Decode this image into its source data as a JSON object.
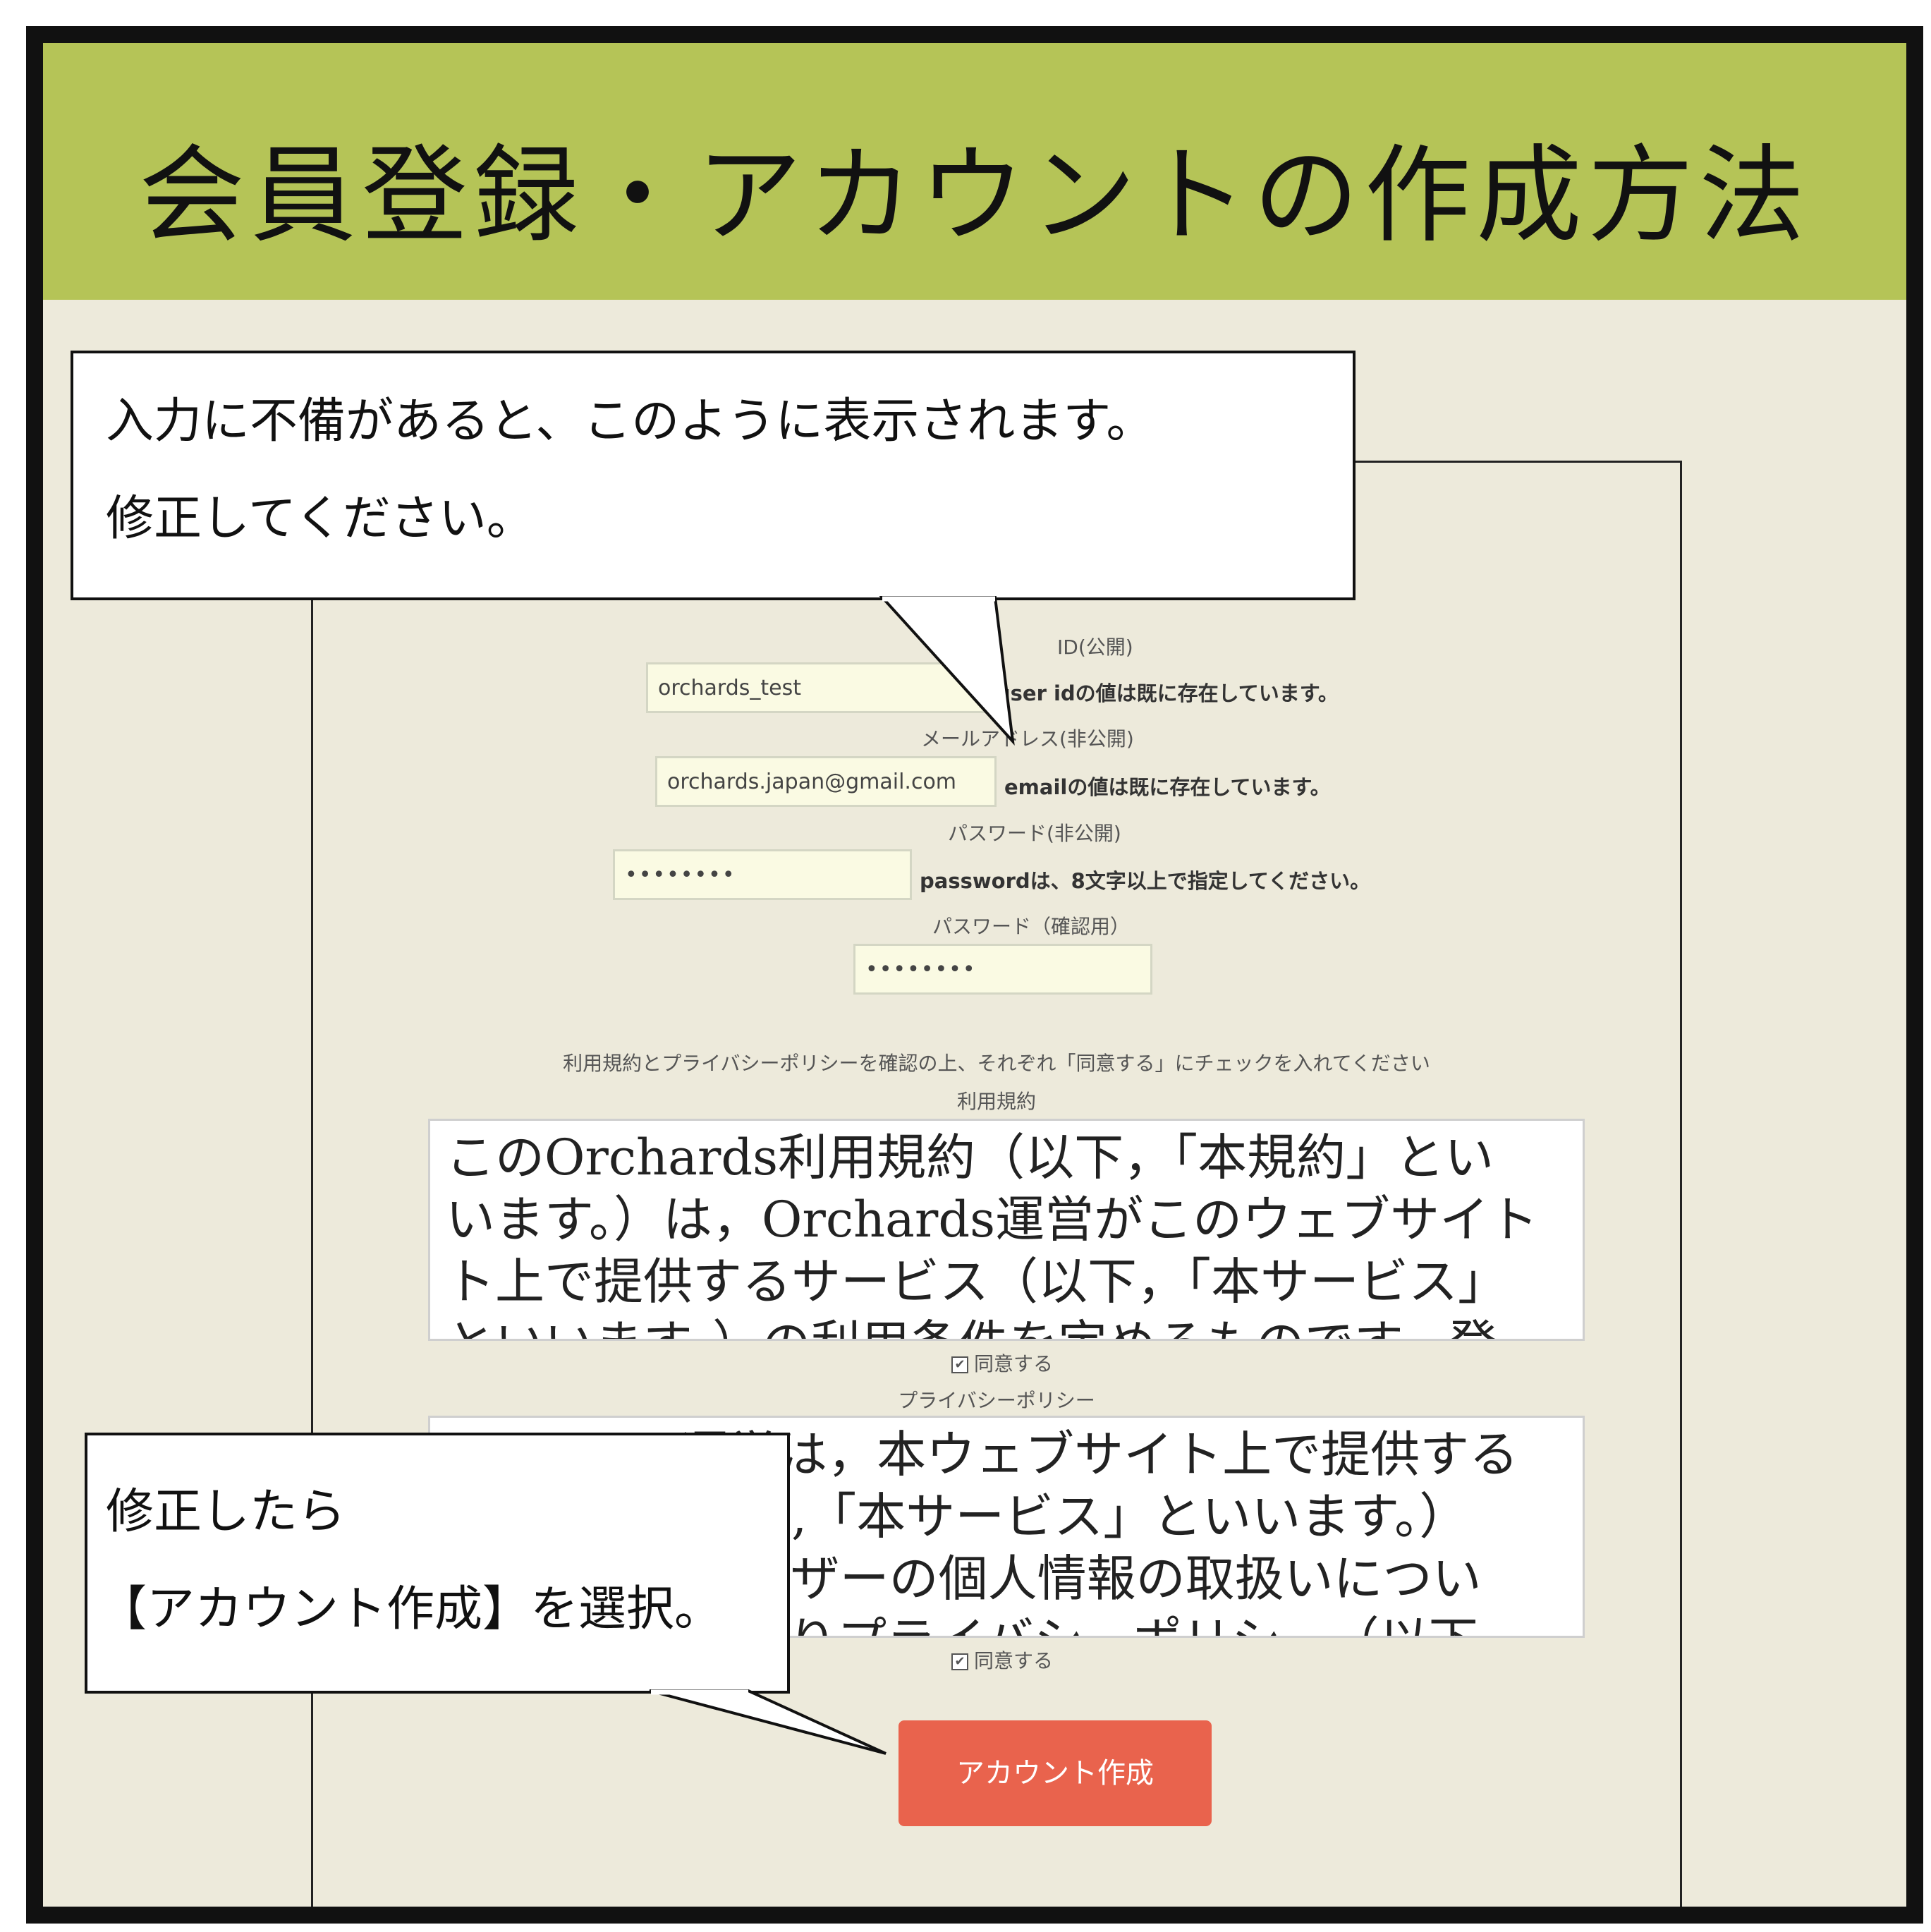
{
  "header": {
    "title": "会員登録・アカウントの作成方法"
  },
  "form": {
    "user_id_label": "ID(公開)",
    "user_id_value": "orchards_test",
    "user_id_error": "user idの値は既に存在しています。",
    "email_label": "メールアドレス(非公開)",
    "email_value": "orchards.japan@gmail.com",
    "email_error": "emailの値は既に存在しています。",
    "password_label": "パスワード(非公開)",
    "password_value": "••••••••",
    "password_error": "passwordは、8文字以上で指定してください。",
    "password_confirm_label": "パスワード（確認用）",
    "password_confirm_value": "••••••••",
    "consent_instruction": "利用規約とプライバシーポリシーを確認の上、それぞれ「同意する」にチェックを入れてください",
    "terms_label": "利用規約",
    "terms_lines": [
      "このOrchards利用規約（以下，「本規約」とい",
      "います。）は，Orchards運営がこのウェブサイト",
      "ト上で提供するサービス（以下，「本サービス」",
      "といいます。）の利用条件を定めるものです。登"
    ],
    "terms_agree": "同意する",
    "privacy_label": "プライバシーポリシー",
    "privacy_lines": [
      "Orchards運営は，本ウェブサイト上で提供する",
      "サービス（以下,「本サービス」といいます。）",
      "における，ユーザーの個人情報の取扱いについ",
      "て，以下のとおりプライバシーポリシー（以下"
    ],
    "privacy_agree": "同意する",
    "create_button": "アカウント作成"
  },
  "callouts": {
    "top_line1": "入力に不備があると、このように表示されます。",
    "top_line2": "修正してください。",
    "bottom_line1": "修正したら",
    "bottom_line2": "【アカウント作成】を選択。"
  },
  "colors": {
    "header": "#b5c457",
    "background": "#edeadb",
    "button": "#e9634d"
  }
}
